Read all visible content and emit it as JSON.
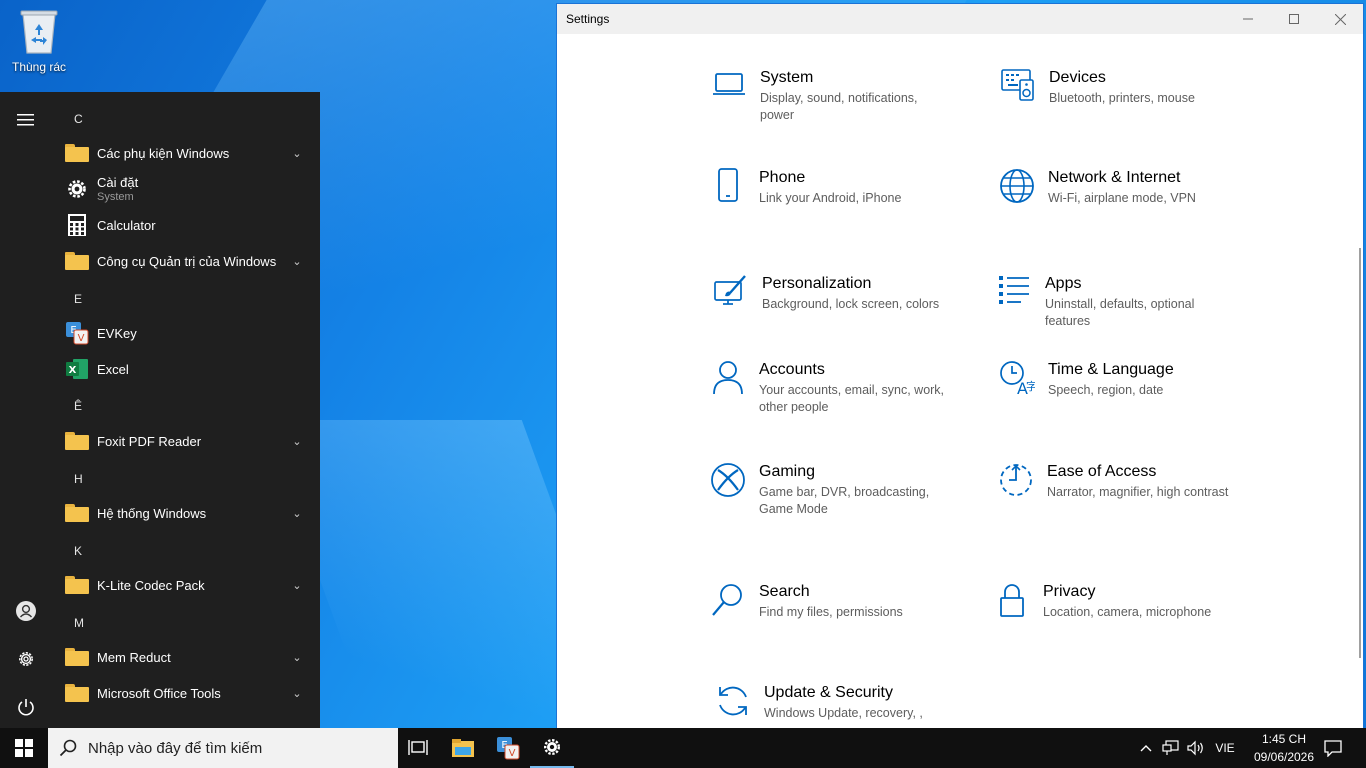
{
  "desktop": {
    "recycle_bin_label": "Thùng rác"
  },
  "start_menu": {
    "items": [
      {
        "kind": "letter",
        "text": "C"
      },
      {
        "kind": "folder",
        "label": "Các phụ kiện Windows"
      },
      {
        "kind": "app",
        "label": "Cài đặt",
        "sub": "System",
        "icon": "gear-icon"
      },
      {
        "kind": "app",
        "label": "Calculator",
        "icon": "calculator-icon"
      },
      {
        "kind": "folder",
        "label": "Công cụ Quản trị của Windows"
      },
      {
        "kind": "letter",
        "text": "E"
      },
      {
        "kind": "app",
        "label": "EVKey",
        "icon": "evkey-icon"
      },
      {
        "kind": "app",
        "label": "Excel",
        "icon": "excel-icon"
      },
      {
        "kind": "letter",
        "text": "Ê"
      },
      {
        "kind": "folder",
        "label": "Foxit PDF Reader"
      },
      {
        "kind": "letter",
        "text": "H"
      },
      {
        "kind": "folder",
        "label": "Hệ thống Windows"
      },
      {
        "kind": "letter",
        "text": "K"
      },
      {
        "kind": "folder",
        "label": "K-Lite Codec Pack"
      },
      {
        "kind": "letter",
        "text": "M"
      },
      {
        "kind": "folder",
        "label": "Mem Reduct"
      },
      {
        "kind": "folder",
        "label": "Microsoft Office Tools"
      }
    ],
    "rail_icons": [
      "hamburger-menu-icon",
      "user-account-icon",
      "settings-gear-icon",
      "power-icon"
    ]
  },
  "settings": {
    "window_title": "Settings",
    "accent": "#0067c0",
    "tiles": [
      {
        "name": "System",
        "desc": "Display, sound, notifications, power",
        "icon": "laptop-icon"
      },
      {
        "name": "Devices",
        "desc": "Bluetooth, printers, mouse",
        "icon": "keyboard-speaker-icon"
      },
      {
        "name": "Phone",
        "desc": "Link your Android, iPhone",
        "icon": "phone-icon"
      },
      {
        "name": "Network & Internet",
        "desc": "Wi-Fi, airplane mode, VPN",
        "icon": "globe-icon"
      },
      {
        "name": "Personalization",
        "desc": "Background, lock screen, colors",
        "icon": "paintbrush-screen-icon"
      },
      {
        "name": "Apps",
        "desc": "Uninstall, defaults, optional features",
        "icon": "apps-list-icon"
      },
      {
        "name": "Accounts",
        "desc": "Your accounts, email, sync, work, other people",
        "icon": "person-icon"
      },
      {
        "name": "Time & Language",
        "desc": "Speech, region, date",
        "icon": "clock-language-icon"
      },
      {
        "name": "Gaming",
        "desc": "Game bar, DVR, broadcasting, Game Mode",
        "icon": "xbox-icon"
      },
      {
        "name": "Ease of Access",
        "desc": "Narrator, magnifier, high contrast",
        "icon": "ease-of-access-icon"
      },
      {
        "name": "Search",
        "desc": "Find my files, permissions",
        "icon": "magnifier-icon"
      },
      {
        "name": "Privacy",
        "desc": "Location, camera, microphone",
        "icon": "lock-icon"
      },
      {
        "name": "Update & Security",
        "desc": "Windows Update, recovery, ,",
        "icon": "sync-arrows-icon"
      }
    ]
  },
  "taskbar": {
    "search_placeholder": "Nhập vào đây để tìm kiếm",
    "language": "VIE",
    "time": "1:45 CH",
    "date": "09/06/2026"
  }
}
